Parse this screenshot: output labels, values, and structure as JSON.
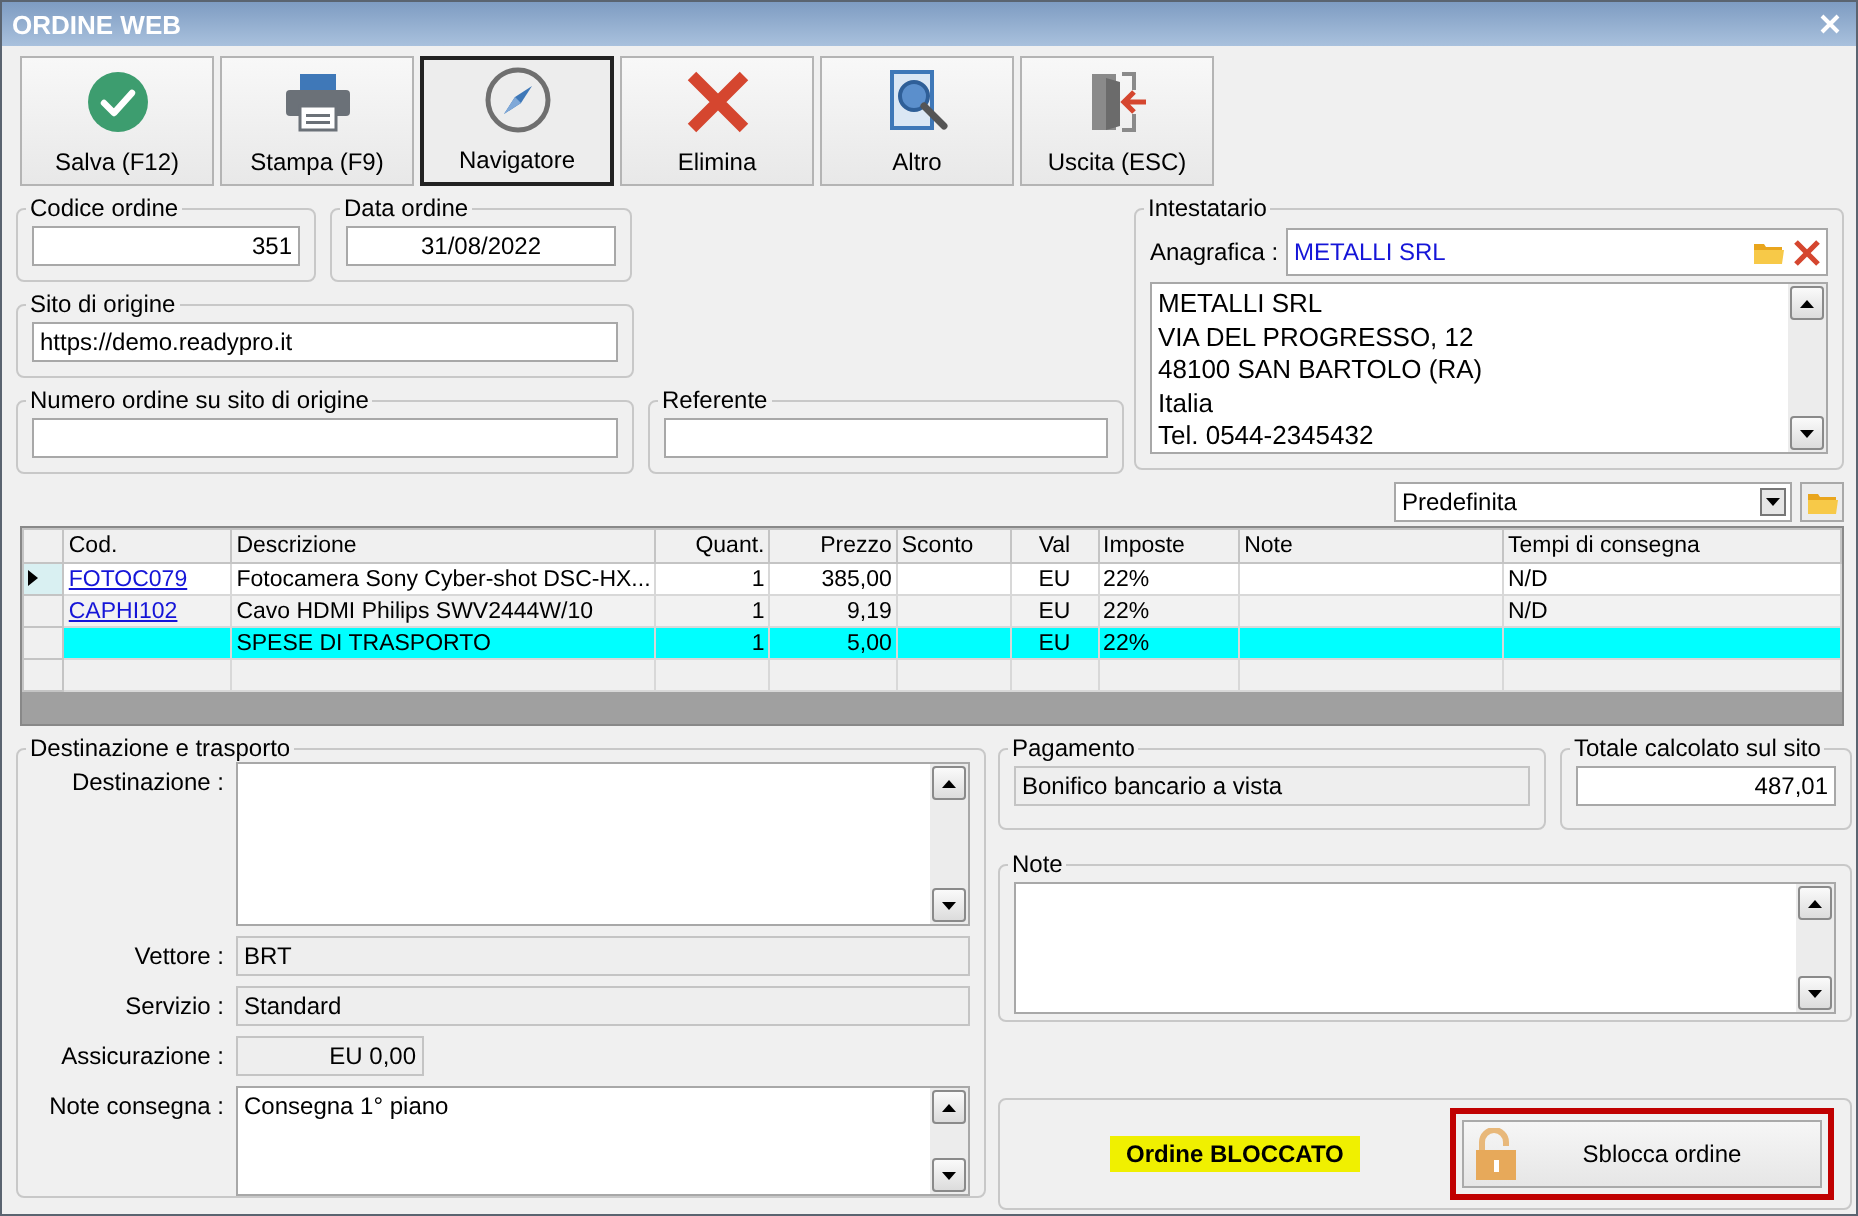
{
  "window": {
    "title": "ORDINE WEB"
  },
  "toolbar": [
    {
      "label": "Salva (F12)",
      "kind": "save",
      "selected": false
    },
    {
      "label": "Stampa (F9)",
      "kind": "print",
      "selected": false
    },
    {
      "label": "Navigatore",
      "kind": "navigate",
      "selected": true
    },
    {
      "label": "Elimina",
      "kind": "delete",
      "selected": false
    },
    {
      "label": "Altro",
      "kind": "more",
      "selected": false
    },
    {
      "label": "Uscita (ESC)",
      "kind": "exit",
      "selected": false
    }
  ],
  "codice_ordine": {
    "label": "Codice ordine",
    "value": "351"
  },
  "data_ordine": {
    "label": "Data ordine",
    "value": "31/08/2022"
  },
  "sito_di_origine": {
    "label": "Sito di origine",
    "value": "https://demo.readypro.it"
  },
  "numero_ordine_sito": {
    "label": "Numero ordine su sito di origine"
  },
  "referente": {
    "label": "Referente"
  },
  "intestatario": {
    "title": "Intestatario",
    "anagrafica_label": "Anagrafica :",
    "anagrafica_value": "METALLI SRL",
    "address_lines": [
      "METALLI SRL",
      "VIA DEL PROGRESSO, 12",
      "48100 SAN BARTOLO (RA)",
      "Italia",
      "Tel. 0544-2345432"
    ]
  },
  "layout_select": {
    "value": "Predefinita"
  },
  "table": {
    "columns": [
      "Cod.",
      "Descrizione",
      "Quant.",
      "Prezzo",
      "Sconto",
      "Val",
      "Imposte",
      "Note",
      "Tempi di consegna"
    ],
    "rows": [
      {
        "current": true,
        "highlighted": false,
        "cells": [
          "FOTOC079",
          "Fotocamera Sony Cyber-shot DSC-HX...",
          "1",
          "385,00",
          null,
          "EU",
          "22%",
          null,
          "N/D"
        ]
      },
      {
        "current": false,
        "highlighted": false,
        "cells": [
          "CAPHI102",
          "Cavo HDMI Philips SWV2444W/10",
          "1",
          "9,19",
          null,
          "EU",
          "22%",
          null,
          "N/D"
        ]
      },
      {
        "current": false,
        "highlighted": true,
        "cells": [
          null,
          "SPESE DI TRASPORTO",
          "1",
          "5,00",
          null,
          "EU",
          "22%",
          null,
          null
        ]
      }
    ]
  },
  "destinazione_trasporto": {
    "title": "Destinazione e trasporto",
    "destinazione_label": "Destinazione :",
    "vettore": {
      "label": "Vettore :",
      "value": "BRT"
    },
    "servizio": {
      "label": "Servizio :",
      "value": "Standard"
    },
    "assicurazione": {
      "label": "Assicurazione :",
      "value": "EU 0,00"
    },
    "note_consegna": {
      "label": "Note consegna :",
      "value": "Consegna 1° piano"
    }
  },
  "pagamento": {
    "title": "Pagamento",
    "value": "Bonifico bancario a vista"
  },
  "totale": {
    "title": "Totale calcolato sul sito",
    "value": "487,01"
  },
  "note": {
    "title": "Note"
  },
  "stato": {
    "badge": "Ordine BLOCCATO",
    "unlock_button": "Sblocca ordine"
  }
}
